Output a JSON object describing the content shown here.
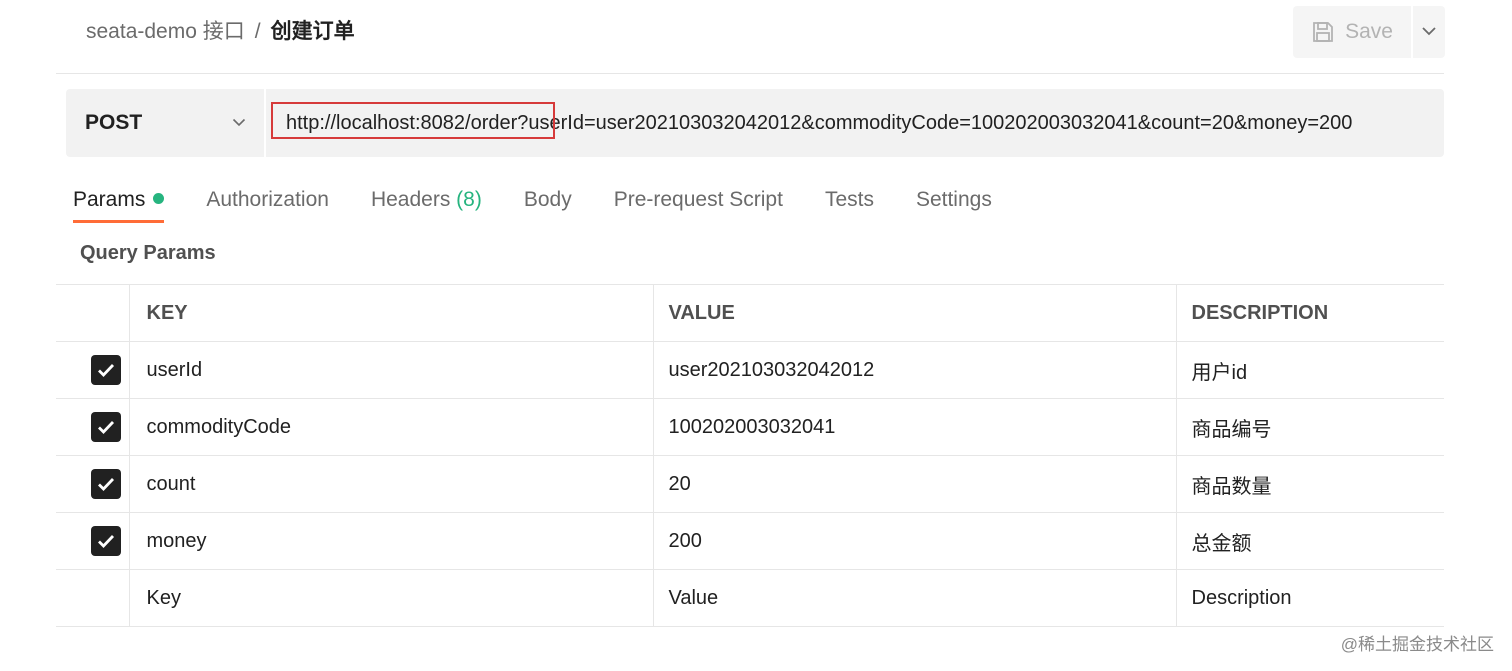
{
  "header": {
    "breadcrumb_parent": "seata-demo 接口",
    "breadcrumb_separator": "/",
    "breadcrumb_current": "创建订单",
    "save_label": "Save"
  },
  "request": {
    "method": "POST",
    "url": "http://localhost:8082/order?userId=user202103032042012&commodityCode=100202003032041&count=20&money=200"
  },
  "tabs": [
    {
      "label": "Params",
      "active": true,
      "has_dot": true
    },
    {
      "label": "Authorization"
    },
    {
      "label": "Headers ",
      "count": "(8)"
    },
    {
      "label": "Body"
    },
    {
      "label": "Pre-request Script"
    },
    {
      "label": "Tests"
    },
    {
      "label": "Settings"
    }
  ],
  "query_params": {
    "title": "Query Params",
    "columns": {
      "key": "KEY",
      "value": "VALUE",
      "description": "DESCRIPTION"
    },
    "rows": [
      {
        "checked": true,
        "key": "userId",
        "value": "user202103032042012",
        "description": "用户id"
      },
      {
        "checked": true,
        "key": "commodityCode",
        "value": "100202003032041",
        "description": "商品编号"
      },
      {
        "checked": true,
        "key": "count",
        "value": "20",
        "description": "商品数量"
      },
      {
        "checked": true,
        "key": "money",
        "value": "200",
        "description": "总金额"
      }
    ],
    "placeholders": {
      "key": "Key",
      "value": "Value",
      "description": "Description"
    }
  },
  "watermark": "@稀土掘金技术社区",
  "colors": {
    "active_tab_underline": "#ff6c37",
    "status_dot": "#26b47f",
    "url_highlight_box": "#d63a3a"
  },
  "icons": {
    "save": "floppy-disk-icon",
    "dropdown": "chevron-down-icon",
    "checkbox": "checkmark-icon"
  }
}
